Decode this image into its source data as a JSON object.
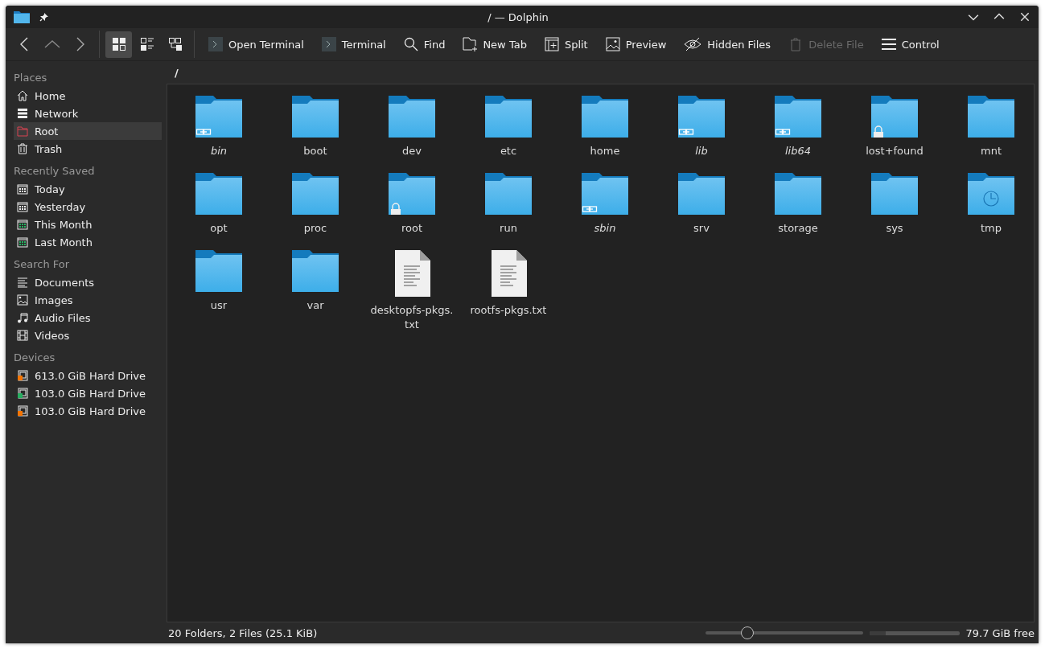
{
  "window": {
    "title": "/ — Dolphin"
  },
  "toolbar": {
    "views": [
      {
        "kind": "icons",
        "selected": true
      },
      {
        "kind": "compact",
        "selected": false
      },
      {
        "kind": "details",
        "selected": false
      }
    ],
    "actions": [
      {
        "kind": "terminal",
        "label": "Open Terminal",
        "disabled": false
      },
      {
        "kind": "terminal",
        "label": "Terminal",
        "disabled": false
      },
      {
        "kind": "find",
        "label": "Find",
        "disabled": false
      },
      {
        "kind": "newtab",
        "label": "New Tab",
        "disabled": false
      },
      {
        "kind": "split",
        "label": "Split",
        "disabled": false
      },
      {
        "kind": "preview",
        "label": "Preview",
        "disabled": false
      },
      {
        "kind": "hidden",
        "label": "Hidden Files",
        "disabled": false
      },
      {
        "kind": "delete",
        "label": "Delete File",
        "disabled": true
      },
      {
        "kind": "menu",
        "label": "Control",
        "disabled": false
      }
    ]
  },
  "sidebar": {
    "sections": [
      {
        "title": "Places",
        "items": [
          {
            "kind": "home",
            "label": "Home",
            "selected": false
          },
          {
            "kind": "network",
            "label": "Network",
            "selected": false
          },
          {
            "kind": "root",
            "label": "Root",
            "selected": true
          },
          {
            "kind": "trash",
            "label": "Trash",
            "selected": false
          }
        ]
      },
      {
        "title": "Recently Saved",
        "items": [
          {
            "kind": "calendar",
            "label": "Today",
            "selected": false
          },
          {
            "kind": "calendar",
            "label": "Yesterday",
            "selected": false
          },
          {
            "kind": "calendar-month",
            "label": "This Month",
            "selected": false
          },
          {
            "kind": "calendar-month",
            "label": "Last Month",
            "selected": false
          }
        ]
      },
      {
        "title": "Search For",
        "items": [
          {
            "kind": "documents",
            "label": "Documents",
            "selected": false
          },
          {
            "kind": "images",
            "label": "Images",
            "selected": false
          },
          {
            "kind": "audio",
            "label": "Audio Files",
            "selected": false
          },
          {
            "kind": "videos",
            "label": "Videos",
            "selected": false
          }
        ]
      },
      {
        "title": "Devices",
        "items": [
          {
            "kind": "drive",
            "label": "613.0 GiB Hard Drive",
            "selected": false,
            "color": "#f67400"
          },
          {
            "kind": "drive",
            "label": "103.0 GiB Hard Drive",
            "selected": false,
            "color": "#27ae60"
          },
          {
            "kind": "drive",
            "label": "103.0 GiB Hard Drive",
            "selected": false,
            "color": "#f67400"
          }
        ]
      }
    ]
  },
  "location": "/",
  "files": [
    {
      "kind": "folder",
      "name": "bin",
      "symlink": true,
      "locked": false
    },
    {
      "kind": "folder",
      "name": "boot",
      "symlink": false,
      "locked": false
    },
    {
      "kind": "folder",
      "name": "dev",
      "symlink": false,
      "locked": false
    },
    {
      "kind": "folder",
      "name": "etc",
      "symlink": false,
      "locked": false
    },
    {
      "kind": "folder",
      "name": "home",
      "symlink": false,
      "locked": false
    },
    {
      "kind": "folder",
      "name": "lib",
      "symlink": true,
      "locked": false
    },
    {
      "kind": "folder",
      "name": "lib64",
      "symlink": true,
      "locked": false
    },
    {
      "kind": "folder",
      "name": "lost+found",
      "symlink": false,
      "locked": true
    },
    {
      "kind": "folder",
      "name": "mnt",
      "symlink": false,
      "locked": false
    },
    {
      "kind": "folder",
      "name": "opt",
      "symlink": false,
      "locked": false
    },
    {
      "kind": "folder",
      "name": "proc",
      "symlink": false,
      "locked": false
    },
    {
      "kind": "folder",
      "name": "root",
      "symlink": false,
      "locked": true
    },
    {
      "kind": "folder",
      "name": "run",
      "symlink": false,
      "locked": false
    },
    {
      "kind": "folder",
      "name": "sbin",
      "symlink": true,
      "locked": false
    },
    {
      "kind": "folder",
      "name": "srv",
      "symlink": false,
      "locked": false
    },
    {
      "kind": "folder",
      "name": "storage",
      "symlink": false,
      "locked": false
    },
    {
      "kind": "folder",
      "name": "sys",
      "symlink": false,
      "locked": false
    },
    {
      "kind": "temp-folder",
      "name": "tmp",
      "symlink": false,
      "locked": false
    },
    {
      "kind": "folder",
      "name": "usr",
      "symlink": false,
      "locked": false
    },
    {
      "kind": "folder",
      "name": "var",
      "symlink": false,
      "locked": false
    },
    {
      "kind": "text",
      "name": "desktopfs-pkgs.\ntxt",
      "symlink": false,
      "locked": false
    },
    {
      "kind": "text",
      "name": "rootfs-pkgs.txt",
      "symlink": false,
      "locked": false
    }
  ],
  "status_bar": {
    "summary": "20 Folders, 2 Files (25.1 KiB)",
    "zoom": {
      "level": 0.27
    },
    "space": {
      "level": 0.18,
      "label": "79.7 GiB free"
    }
  }
}
